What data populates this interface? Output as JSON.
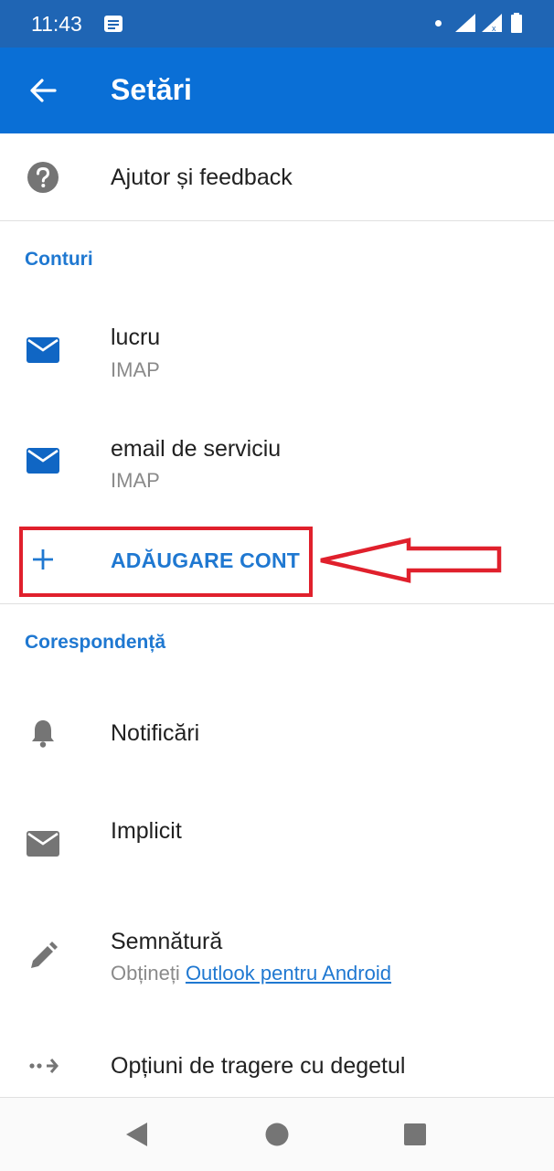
{
  "status_bar": {
    "time": "11:43",
    "icons": [
      "notes-icon",
      "dot-icon",
      "signal-icon",
      "signal-no-data-icon",
      "battery-icon"
    ]
  },
  "app_bar": {
    "title": "Setări",
    "back_icon": "arrow-left-icon",
    "color": "#0a6fd6"
  },
  "help": {
    "label": "Ajutor și feedback",
    "icon": "help-circle-icon"
  },
  "accounts": {
    "section_title": "Conturi",
    "items": [
      {
        "name": "lucru",
        "type": "IMAP",
        "icon": "mail-icon"
      },
      {
        "name": "email de serviciu",
        "type": "IMAP",
        "icon": "mail-icon"
      }
    ],
    "add_label": "ADĂUGARE CONT",
    "highlight_color": "#e0202c"
  },
  "mail": {
    "section_title": "Corespondență",
    "items": [
      {
        "label": "Notificări",
        "icon": "bell-icon"
      },
      {
        "label": "Implicit",
        "icon": "mail-icon"
      },
      {
        "label": "Semnătură",
        "sub_prefix": "Obțineți ",
        "sub_link": "Outlook pentru Android",
        "icon": "pen-icon"
      },
      {
        "label": "Opțiuni de tragere cu degetul",
        "icon": "swipe-arrow-icon"
      }
    ]
  },
  "nav_bar": {
    "icons": [
      "back-triangle-icon",
      "home-circle-icon",
      "recents-square-icon"
    ]
  },
  "accent_color": "#1f78d1"
}
